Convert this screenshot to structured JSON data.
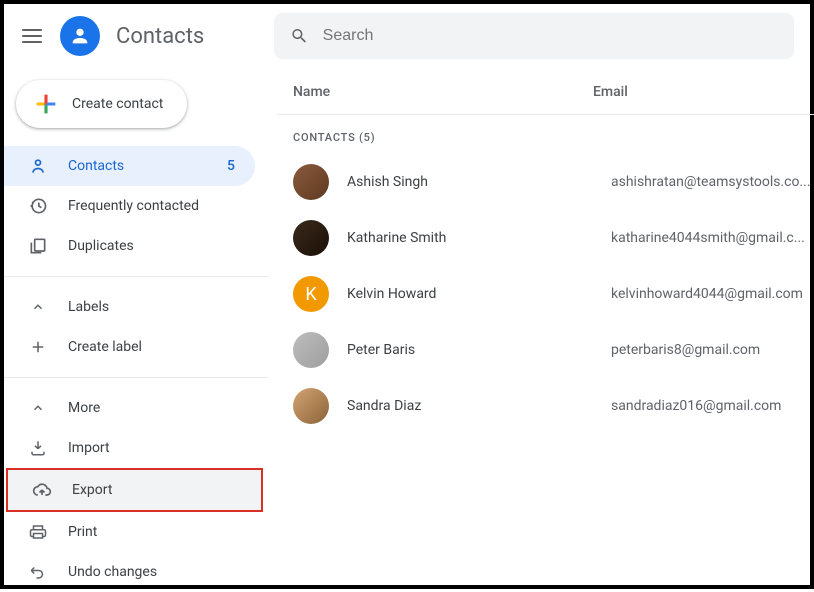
{
  "header": {
    "app_title": "Contacts",
    "search_placeholder": "Search"
  },
  "sidebar": {
    "create_label": "Create contact",
    "items": [
      {
        "label": "Contacts",
        "count": "5"
      },
      {
        "label": "Frequently contacted"
      },
      {
        "label": "Duplicates"
      }
    ],
    "labels_section": [
      {
        "label": "Labels"
      },
      {
        "label": "Create label"
      }
    ],
    "more_section": [
      {
        "label": "More"
      },
      {
        "label": "Import"
      },
      {
        "label": "Export"
      },
      {
        "label": "Print"
      },
      {
        "label": "Undo changes"
      }
    ]
  },
  "table": {
    "col_name": "Name",
    "col_email": "Email",
    "section_label": "CONTACTS (5)",
    "rows": [
      {
        "name": "Ashish Singh",
        "email": "ashishratan@teamsystools.co...",
        "avatar_bg": "linear-gradient(135deg,#8b5a3c,#5c3a22)",
        "initial": ""
      },
      {
        "name": "Katharine Smith",
        "email": "katharine4044smith@gmail.c...",
        "avatar_bg": "linear-gradient(135deg,#3a2a1a,#1a0f08)",
        "initial": ""
      },
      {
        "name": "Kelvin Howard",
        "email": "kelvinhoward4044@gmail.com",
        "avatar_bg": "#f29900",
        "initial": "K"
      },
      {
        "name": "Peter Baris",
        "email": "peterbaris8@gmail.com",
        "avatar_bg": "linear-gradient(135deg,#bdbdbd,#9e9e9e)",
        "initial": ""
      },
      {
        "name": "Sandra Diaz",
        "email": "sandradiaz016@gmail.com",
        "avatar_bg": "linear-gradient(135deg,#d4a574,#8b6239)",
        "initial": ""
      }
    ]
  }
}
